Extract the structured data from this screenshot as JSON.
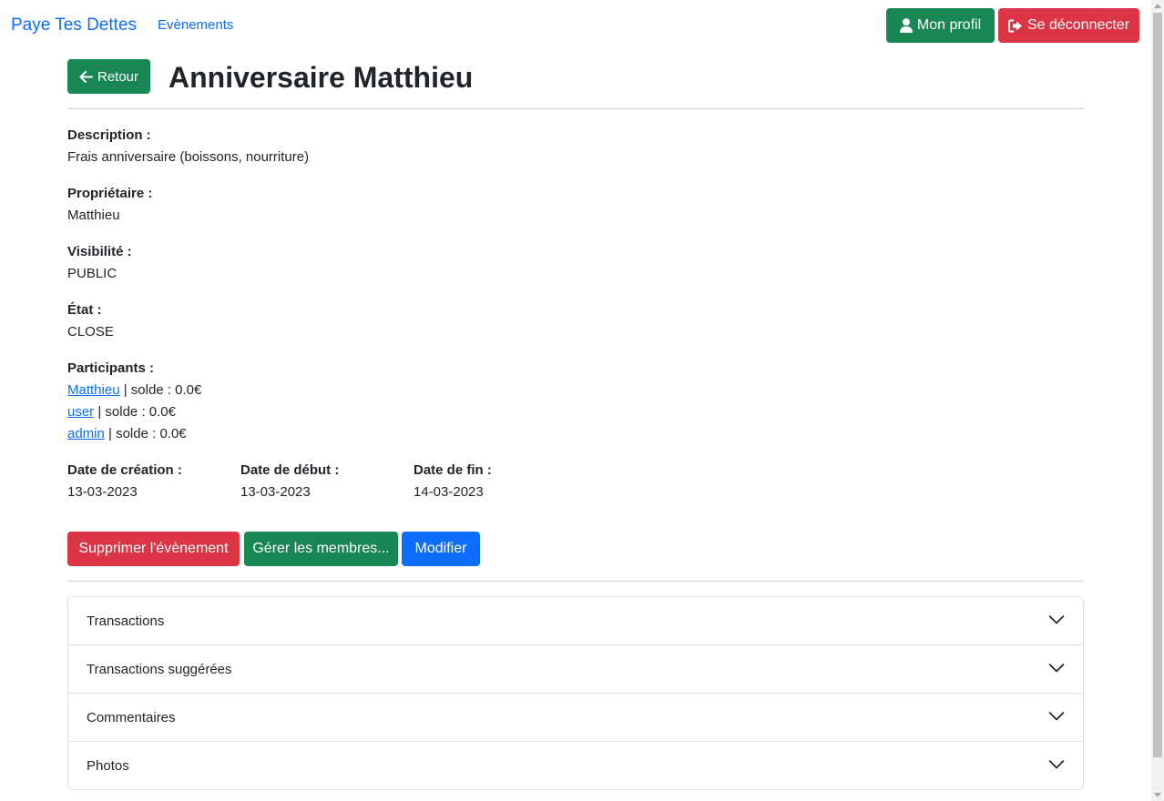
{
  "navbar": {
    "brand": "Paye Tes Dettes",
    "events_link": "Evènements",
    "profile_button": "Mon profil",
    "logout_button": "Se déconnecter"
  },
  "header": {
    "back_button": "Retour",
    "title": "Anniversaire Matthieu"
  },
  "details": {
    "description_label": "Description :",
    "description_value": "Frais anniversaire (boissons, nourriture)",
    "owner_label": "Propriétaire :",
    "owner_value": "Matthieu",
    "visibility_label": "Visibilité :",
    "visibility_value": "PUBLIC",
    "state_label": "État :",
    "state_value": "CLOSE",
    "participants_label": "Participants :",
    "participants": [
      {
        "name": "Matthieu",
        "balance_text": " | solde : 0.0€"
      },
      {
        "name": "user",
        "balance_text": " | solde : 0.0€"
      },
      {
        "name": "admin",
        "balance_text": " | solde : 0.0€"
      }
    ],
    "created_label": "Date de création :",
    "created_value": "13-03-2023",
    "start_label": "Date de début :",
    "start_value": "13-03-2023",
    "end_label": "Date de fin :",
    "end_value": "14-03-2023"
  },
  "actions": {
    "delete_button": "Supprimer l'évènement",
    "members_button": "Gérer les membres...",
    "edit_button": "Modifier"
  },
  "accordion": [
    {
      "label": "Transactions"
    },
    {
      "label": "Transactions suggérées"
    },
    {
      "label": "Commentaires"
    },
    {
      "label": "Photos"
    }
  ],
  "colors": {
    "primary": "#0d6efd",
    "success": "#198754",
    "danger": "#dc3545"
  },
  "icons": {
    "profile_icon": "user-icon",
    "logout_icon": "sign-out-icon",
    "back_icon": "arrow-left-icon",
    "accordion_icon": "chevron-down-icon"
  }
}
